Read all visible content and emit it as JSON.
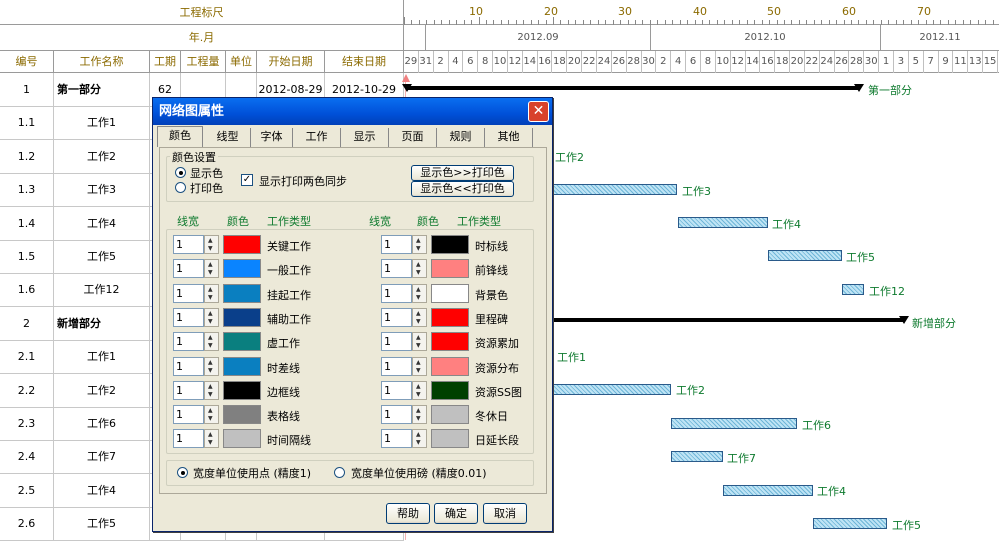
{
  "header": {
    "ruler_label": "工程标尺",
    "ruler_marks": [
      "10",
      "20",
      "30",
      "40",
      "50",
      "60",
      "70"
    ],
    "year_month_label": "年.月",
    "months": [
      "2012.09",
      "2012.10",
      "2012.11"
    ],
    "days": [
      "29",
      "31",
      "2",
      "4",
      "6",
      "8",
      "10",
      "12",
      "14",
      "16",
      "18",
      "20",
      "22",
      "24",
      "26",
      "28",
      "30",
      "2",
      "4",
      "6",
      "8",
      "10",
      "12",
      "14",
      "16",
      "18",
      "20",
      "22",
      "24",
      "26",
      "28",
      "30",
      "1",
      "3",
      "5",
      "7",
      "9",
      "11",
      "13",
      "15"
    ]
  },
  "columns": [
    "编号",
    "工作名称",
    "工期",
    "工程量",
    "单位",
    "开始日期",
    "结束日期"
  ],
  "rows": [
    {
      "id": "1",
      "name": "第一部分",
      "duration": "62",
      "start": "2012-08-29",
      "end": "2012-10-29",
      "bold": true
    },
    {
      "id": "1.1",
      "name": "工作1"
    },
    {
      "id": "1.2",
      "name": "工作2"
    },
    {
      "id": "1.3",
      "name": "工作3"
    },
    {
      "id": "1.4",
      "name": "工作4"
    },
    {
      "id": "1.5",
      "name": "工作5"
    },
    {
      "id": "1.6",
      "name": "工作12"
    },
    {
      "id": "2",
      "name": "新增部分",
      "bold": true
    },
    {
      "id": "2.1",
      "name": "工作1"
    },
    {
      "id": "2.2",
      "name": "工作2"
    },
    {
      "id": "2.3",
      "name": "工作6"
    },
    {
      "id": "2.4",
      "name": "工作7"
    },
    {
      "id": "2.5",
      "name": "工作4"
    },
    {
      "id": "2.6",
      "name": "工作5"
    }
  ],
  "gantt_labels": {
    "part1": "第一部分",
    "w2a": "工作2",
    "w3": "工作3",
    "w4": "工作4",
    "w5": "工作5",
    "w12": "工作12",
    "part2": "新增部分",
    "w1b": "工作1",
    "w2b": "工作2",
    "w6": "工作6",
    "w7": "工作7",
    "w4b": "工作4",
    "w5b": "工作5"
  },
  "dialog": {
    "title": "网络图属性",
    "tabs": [
      "颜色",
      "线型",
      "字体",
      "工作",
      "显示",
      "页面",
      "规则",
      "其他"
    ],
    "active_tab": "颜色",
    "color_settings_title": "颜色设置",
    "radio_display": "显示色",
    "radio_print": "打印色",
    "sync_checkbox": "显示打印两色同步",
    "btn_to_print": "显示色>>打印色",
    "btn_from_print": "显示色<<打印色",
    "col_width": "线宽",
    "col_color": "颜色",
    "col_type": "工作类型",
    "left_items": [
      {
        "width": "1",
        "color": "#ff0000",
        "label": "关键工作"
      },
      {
        "width": "1",
        "color": "#0a84ff",
        "label": "一般工作"
      },
      {
        "width": "1",
        "color": "#0a7fc0",
        "label": "挂起工作"
      },
      {
        "width": "1",
        "color": "#0a3f8a",
        "label": "辅助工作"
      },
      {
        "width": "1",
        "color": "#0a7f7f",
        "label": "虚工作"
      },
      {
        "width": "1",
        "color": "#0a7fc0",
        "label": "时差线"
      },
      {
        "width": "1",
        "color": "#000000",
        "label": "边框线"
      },
      {
        "width": "1",
        "color": "#808080",
        "label": "表格线"
      },
      {
        "width": "1",
        "color": "#c0c0c0",
        "label": "时间隔线"
      }
    ],
    "right_items": [
      {
        "width": "1",
        "color": "#000000",
        "label": "时标线"
      },
      {
        "width": "1",
        "color": "#ff8080",
        "label": "前锋线"
      },
      {
        "width": "1",
        "color": "#ffffff",
        "label": "背景色"
      },
      {
        "width": "1",
        "color": "#ff0000",
        "label": "里程碑"
      },
      {
        "width": "1",
        "color": "#ff0000",
        "label": "资源累加"
      },
      {
        "width": "1",
        "color": "#ff8080",
        "label": "资源分布"
      },
      {
        "width": "1",
        "color": "#004000",
        "label": "资源SS图"
      },
      {
        "width": "1",
        "color": "#c0c0c0",
        "label": "冬休日"
      },
      {
        "width": "1",
        "color": "#c0c0c0",
        "label": "日延长段"
      }
    ],
    "unit_point": "宽度单位使用点 (精度1)",
    "unit_pound": "宽度单位使用磅 (精度0.01)",
    "btn_help": "帮助",
    "btn_ok": "确定",
    "btn_cancel": "取消"
  }
}
